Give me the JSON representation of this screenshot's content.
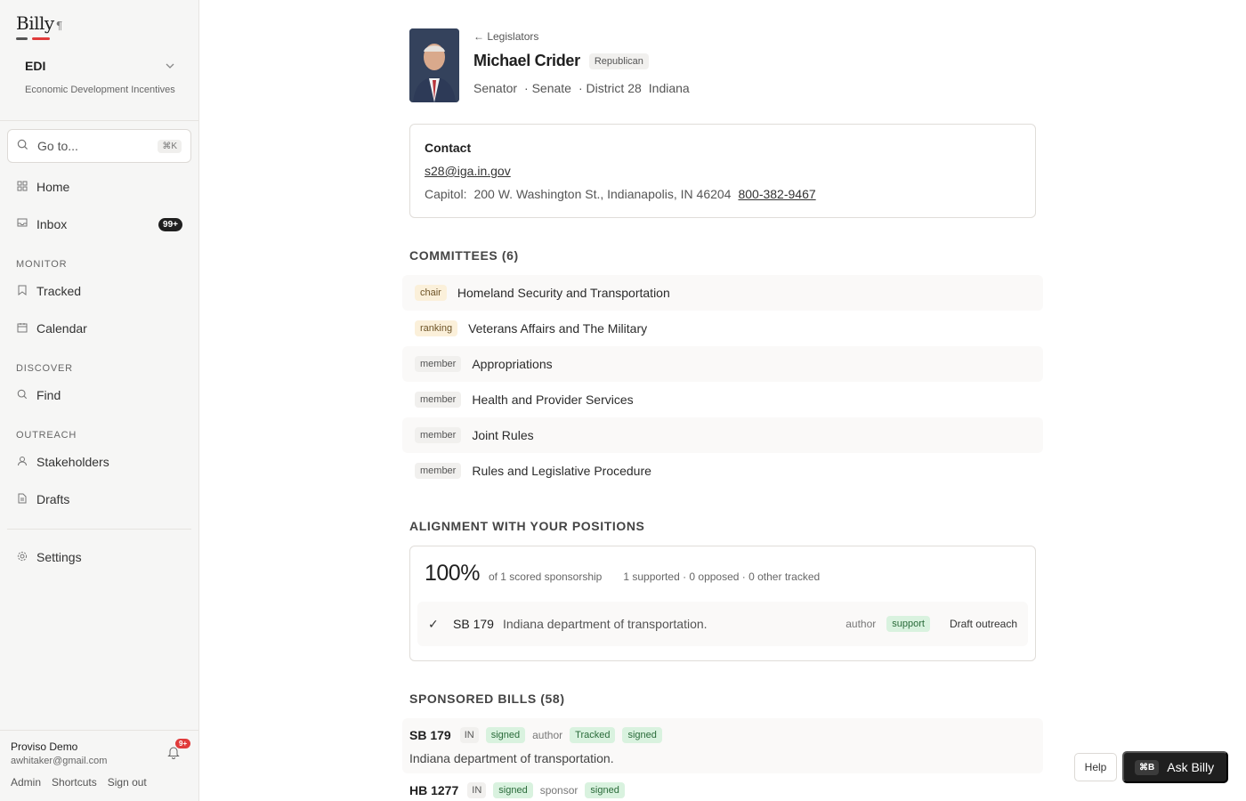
{
  "app": {
    "logo": "Billy",
    "logo_mark": "¶",
    "colors": {
      "accent_red": "#e03b3b",
      "accent_dark": "#555555"
    }
  },
  "sidebar": {
    "workspace": {
      "name": "EDI",
      "description": "Economic Development Incentives"
    },
    "search": {
      "placeholder": "Go to...",
      "shortcut": "⌘K"
    },
    "nav": [
      {
        "label": "Home",
        "icon": "home-icon"
      },
      {
        "label": "Inbox",
        "icon": "inbox-icon",
        "badge": "99+"
      }
    ],
    "sections": [
      {
        "label": "MONITOR",
        "items": [
          {
            "label": "Tracked",
            "icon": "bookmark-icon"
          },
          {
            "label": "Calendar",
            "icon": "calendar-icon"
          }
        ]
      },
      {
        "label": "DISCOVER",
        "items": [
          {
            "label": "Find",
            "icon": "search-icon"
          }
        ]
      },
      {
        "label": "OUTREACH",
        "items": [
          {
            "label": "Stakeholders",
            "icon": "person-icon"
          },
          {
            "label": "Drafts",
            "icon": "document-icon"
          }
        ]
      }
    ],
    "settings": {
      "label": "Settings",
      "icon": "gear-icon"
    },
    "user": {
      "name": "Proviso Demo",
      "email": "awhitaker@gmail.com",
      "notifications": "9+"
    },
    "footer_links": [
      "Admin",
      "Shortcuts",
      "Sign out"
    ]
  },
  "legislator": {
    "back_label": "← Legislators",
    "name": "Michael Crider",
    "party": "Republican",
    "title": "Senator",
    "chamber": "· Senate",
    "district": "· District 28",
    "state": "Indiana"
  },
  "contact": {
    "heading": "Contact",
    "email": "s28@iga.in.gov",
    "address_label": "Capitol:",
    "address": "200 W. Washington St., Indianapolis, IN 46204",
    "phone": "800-382-9467"
  },
  "committees": {
    "heading": "COMMITTEES (6)",
    "items": [
      {
        "role": "chair",
        "name": "Homeland Security and Transportation"
      },
      {
        "role": "ranking",
        "name": "Veterans Affairs and The Military"
      },
      {
        "role": "member",
        "name": "Appropriations"
      },
      {
        "role": "member",
        "name": "Health and Provider Services"
      },
      {
        "role": "member",
        "name": "Joint Rules"
      },
      {
        "role": "member",
        "name": "Rules and Legislative Procedure"
      }
    ]
  },
  "alignment": {
    "heading": "ALIGNMENT WITH YOUR POSITIONS",
    "percent": "100%",
    "scored_note": "of 1 scored sponsorship",
    "summary": "1 supported · 0 opposed · 0 other tracked",
    "rows": [
      {
        "check": "✓",
        "bill": "SB 179",
        "title": "Indiana department of transportation.",
        "role": "author",
        "position": "support",
        "action": "Draft outreach"
      }
    ]
  },
  "sponsored": {
    "heading": "SPONSORED BILLS (58)",
    "bills": [
      {
        "number": "SB 179",
        "state": "IN",
        "status": "signed",
        "role": "author",
        "tracked": "Tracked",
        "position_status": "signed",
        "description": "Indiana department of transportation."
      },
      {
        "number": "HB 1277",
        "state": "IN",
        "status": "signed",
        "role": "sponsor",
        "position_status": "signed"
      }
    ]
  },
  "actions": {
    "help": "Help",
    "ask_shortcut": "⌘B",
    "ask_label": "Ask Billy"
  }
}
